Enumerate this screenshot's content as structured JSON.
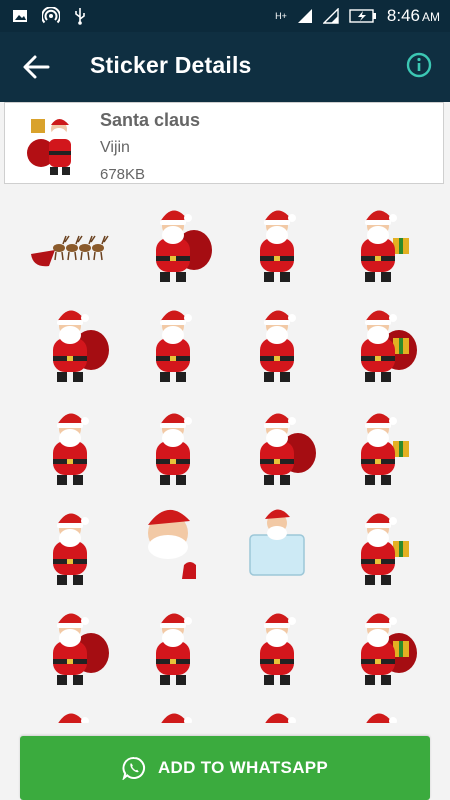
{
  "status_bar": {
    "time": "8:46",
    "ampm": "AM",
    "network": "H+",
    "icons": [
      "image-icon",
      "hotspot-icon",
      "usb-icon",
      "signal-icon",
      "signal-icon",
      "battery-icon"
    ]
  },
  "app_bar": {
    "title": "Sticker Details",
    "back_icon": "arrow-left-icon",
    "info_icon": "info-icon"
  },
  "pack": {
    "name": "Santa claus",
    "author": "Vijin",
    "size": "678KB"
  },
  "stickers": [
    {
      "name": "santa-sleigh-reindeer"
    },
    {
      "name": "santa-gift-sack"
    },
    {
      "name": "santa-toy-bag"
    },
    {
      "name": "santa-gift-boxes"
    },
    {
      "name": "santa-bow-belly"
    },
    {
      "name": "santa-bell-sack"
    },
    {
      "name": "santa-walking-sack"
    },
    {
      "name": "santa-arms-up-gifts"
    },
    {
      "name": "santa-presents-stack"
    },
    {
      "name": "santa-handstand"
    },
    {
      "name": "santa-peek"
    },
    {
      "name": "santa-sign"
    },
    {
      "name": "santa-holding-sack"
    },
    {
      "name": "santa-face-mitten"
    },
    {
      "name": "santa-blank-board"
    },
    {
      "name": "santa-gift-raise"
    },
    {
      "name": "santa-thumbs"
    },
    {
      "name": "santa-pulling-sack"
    },
    {
      "name": "santa-running-sack"
    },
    {
      "name": "santa-pointing"
    }
  ],
  "action": {
    "label": "ADD TO WHATSAPP",
    "icon": "whatsapp-icon"
  },
  "colors": {
    "status_bar": "#0c2a3b",
    "app_bar": "#0f2f41",
    "info_accent": "#3cc8b4",
    "button": "#3bab3e"
  }
}
